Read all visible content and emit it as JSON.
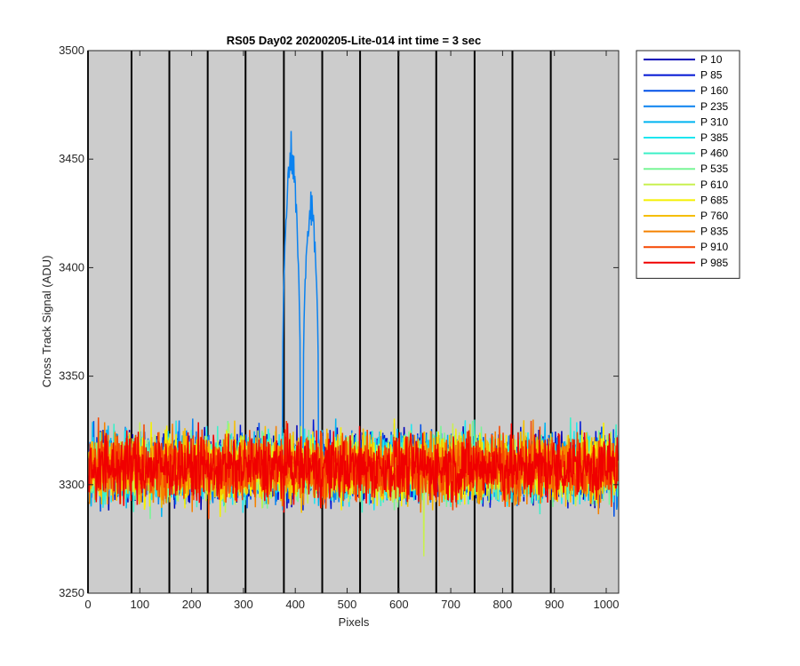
{
  "chart_data": {
    "type": "line",
    "title": "RS05 Day02 20200205-Lite-014 int time = 3 sec",
    "xlabel": "Pixels",
    "ylabel": "Cross Track Signal (ADU)",
    "xlim": [
      0,
      1024
    ],
    "ylim": [
      3250,
      3500
    ],
    "xticks": [
      "0",
      "100",
      "200",
      "300",
      "400",
      "500",
      "600",
      "700",
      "800",
      "900",
      "1000"
    ],
    "yticks": [
      "3250",
      "3300",
      "3350",
      "3400",
      "3450",
      "3500"
    ],
    "background_color": "#cccccc",
    "vertical_lines_x": [
      0,
      84,
      157,
      231,
      304,
      378,
      452,
      525,
      599,
      672,
      746,
      819,
      893
    ],
    "legend_position": "outside-top-right",
    "grid": false,
    "baseline_mean": 3308,
    "baseline_noise_range": [
      3283,
      3337
    ],
    "series": [
      {
        "name": "P 10",
        "color": "#0000b8"
      },
      {
        "name": "P 85",
        "color": "#0014d4"
      },
      {
        "name": "P 160",
        "color": "#0050e8"
      },
      {
        "name": "P 235",
        "color": "#0a82f0",
        "peaks": [
          {
            "x_range": [
              375,
              410
            ],
            "max": 3468
          },
          {
            "x_range": [
              415,
              445
            ],
            "max": 3446
          }
        ]
      },
      {
        "name": "P 310",
        "color": "#00b4f0"
      },
      {
        "name": "P 385",
        "color": "#1ee6f0"
      },
      {
        "name": "P 460",
        "color": "#3cf0c8"
      },
      {
        "name": "P 535",
        "color": "#78f596"
      },
      {
        "name": "P 610",
        "color": "#c8f050",
        "dip": {
          "x": 648,
          "min": 3267
        }
      },
      {
        "name": "P 685",
        "color": "#f5f000"
      },
      {
        "name": "P 760",
        "color": "#f5be00"
      },
      {
        "name": "P 835",
        "color": "#f58200"
      },
      {
        "name": "P 910",
        "color": "#f54600"
      },
      {
        "name": "P 985",
        "color": "#f00000"
      }
    ]
  }
}
